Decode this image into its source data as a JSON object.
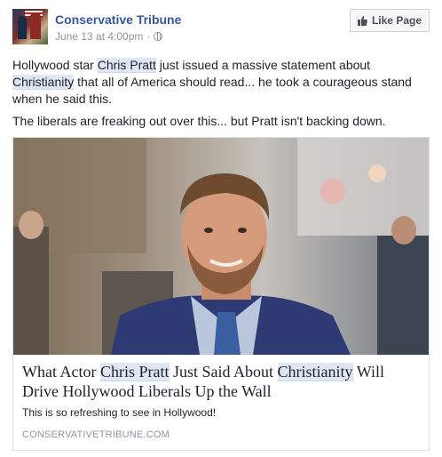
{
  "header": {
    "page_name": "Conservative Tribune",
    "timestamp": "June 13 at 4:00pm",
    "separator": "·",
    "like_button_label": "Like Page",
    "privacy_icon": "globe-icon"
  },
  "post": {
    "p1_a": "Hollywood star ",
    "p1_link1": "Chris Pratt",
    "p1_b": " just issued a massive statement about ",
    "p1_link2": "Christianity",
    "p1_c": " that all of America should read... he took a courageous stand when he said this.",
    "p2": "The liberals are freaking out over this... but Pratt isn't backing down."
  },
  "card": {
    "title_a": "What Actor ",
    "title_link1": "Chris Pratt",
    "title_b": " Just Said About ",
    "title_link2": "Christianity",
    "title_c": " Will Drive Hollywood Liberals Up the Wall",
    "description": "This is so refreshing to see in Hollywood!",
    "domain": "CONSERVATIVETRIBUNE.COM"
  },
  "colors": {
    "link_blue": "#365899",
    "meta_gray": "#90949c",
    "highlight": "#dfe7f5"
  }
}
